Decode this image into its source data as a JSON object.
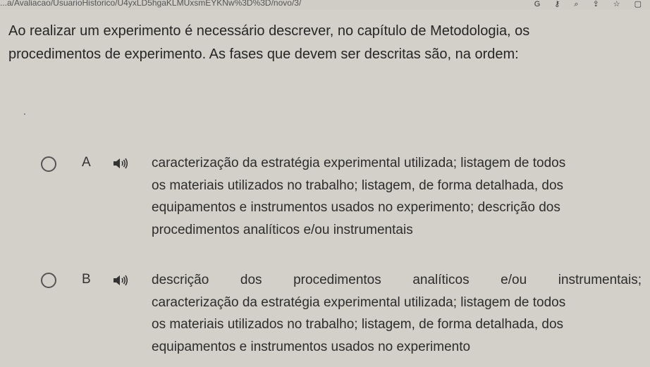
{
  "browser": {
    "url": "...a/Avaliacao/UsuarioHistorico/U4yxLD5hgaKLMUxsmEYKNw%3D%3D/novo/3/"
  },
  "question": {
    "line1": "Ao realizar um experimento é necessário descrever, no capítulo de Metodologia, os",
    "line2": "procedimentos de experimento. As fases que devem ser descritas são, na ordem:"
  },
  "options": [
    {
      "letter": "A",
      "lines": [
        "caracterização da estratégia experimental utilizada; listagem de todos",
        "os materiais utilizados no trabalho; listagem, de forma detalhada, dos",
        "equipamentos e instrumentos usados no experimento; descrição dos",
        "procedimentos analíticos e/ou instrumentais"
      ]
    },
    {
      "letter": "B",
      "lines": [
        "descrição dos procedimentos analíticos e/ou instrumentais;",
        "caracterização da estratégia experimental utilizada; listagem de todos",
        "os materiais utilizados no trabalho; listagem, de forma detalhada, dos",
        "equipamentos e instrumentos usados no experimento"
      ]
    }
  ],
  "colors": {
    "background": "#d2d0c8",
    "text": "#2a2a2a",
    "radio_border": "#555555"
  }
}
